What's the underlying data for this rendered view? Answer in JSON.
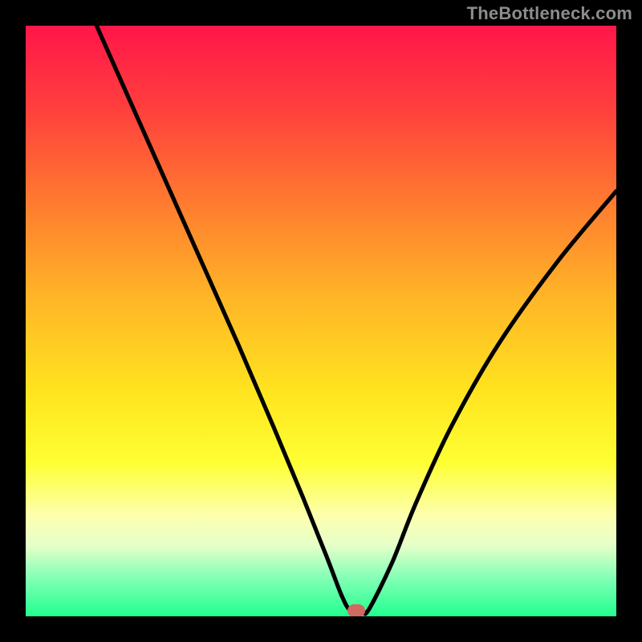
{
  "attribution": "TheBottleneck.com",
  "chart_data": {
    "type": "line",
    "title": "",
    "xlabel": "",
    "ylabel": "",
    "xlim": [
      0,
      100
    ],
    "ylim": [
      0,
      100
    ],
    "series": [
      {
        "name": "bottleneck-curve",
        "x": [
          12,
          20,
          28,
          36,
          42,
          47,
          51,
          53.5,
          55,
          57,
          58,
          62,
          66,
          72,
          80,
          90,
          100
        ],
        "values": [
          100,
          82,
          64,
          46,
          32,
          20,
          10,
          3.5,
          1,
          1,
          1,
          9,
          19,
          32,
          46,
          60,
          72
        ]
      }
    ],
    "min_marker": {
      "x": 56,
      "y": 1
    },
    "colors": {
      "curve": "#000000",
      "marker": "#d0695f",
      "gradient_top": "#ff164a",
      "gradient_bottom": "#21ff8f",
      "frame": "#000000"
    }
  }
}
